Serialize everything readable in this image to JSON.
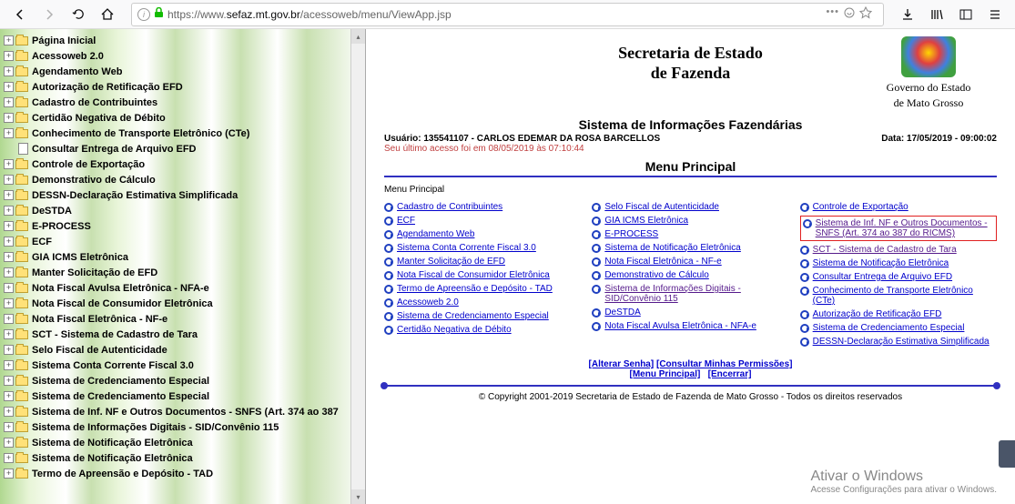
{
  "browser": {
    "url_prefix": "https://www.",
    "url_domain": "sefaz.mt.gov.br",
    "url_path": "/acessoweb/menu/ViewApp.jsp"
  },
  "tree": [
    {
      "label": "Página Inicial",
      "icon": "folder"
    },
    {
      "label": "Acessoweb 2.0",
      "icon": "folder"
    },
    {
      "label": "Agendamento Web",
      "icon": "folder"
    },
    {
      "label": "Autorização de Retificação EFD",
      "icon": "folder"
    },
    {
      "label": "Cadastro de Contribuintes",
      "icon": "folder"
    },
    {
      "label": "Certidão Negativa de Débito",
      "icon": "folder"
    },
    {
      "label": "Conhecimento de Transporte Eletrônico (CTe)",
      "icon": "folder"
    },
    {
      "label": "Consultar Entrega de Arquivo EFD",
      "icon": "doc",
      "child": true
    },
    {
      "label": "Controle de Exportação",
      "icon": "folder"
    },
    {
      "label": "Demonstrativo de Cálculo",
      "icon": "folder"
    },
    {
      "label": "DESSN-Declaração Estimativa Simplificada",
      "icon": "folder"
    },
    {
      "label": "DeSTDA",
      "icon": "folder"
    },
    {
      "label": "E-PROCESS",
      "icon": "folder"
    },
    {
      "label": "ECF",
      "icon": "folder"
    },
    {
      "label": "GIA ICMS Eletrônica",
      "icon": "folder"
    },
    {
      "label": "Manter Solicitação de EFD",
      "icon": "folder"
    },
    {
      "label": "Nota Fiscal Avulsa Eletrônica - NFA-e",
      "icon": "folder"
    },
    {
      "label": "Nota Fiscal de Consumidor Eletrônica",
      "icon": "folder"
    },
    {
      "label": "Nota Fiscal Eletrônica - NF-e",
      "icon": "folder"
    },
    {
      "label": "SCT - Sistema de Cadastro de Tara",
      "icon": "folder"
    },
    {
      "label": "Selo Fiscal de Autenticidade",
      "icon": "folder"
    },
    {
      "label": "Sistema Conta Corrente Fiscal 3.0",
      "icon": "folder"
    },
    {
      "label": "Sistema de Credenciamento Especial",
      "icon": "folder"
    },
    {
      "label": "Sistema de Credenciamento Especial",
      "icon": "folder"
    },
    {
      "label": "Sistema de Inf. NF e Outros Documentos - SNFS (Art. 374 ao 387",
      "icon": "folder"
    },
    {
      "label": "Sistema de Informações Digitais - SID/Convênio 115",
      "icon": "folder"
    },
    {
      "label": "Sistema de Notificação Eletrônica",
      "icon": "folder"
    },
    {
      "label": "Sistema de Notificação Eletrônica",
      "icon": "folder"
    },
    {
      "label": "Termo de Apreensão e Depósito - TAD",
      "icon": "folder"
    }
  ],
  "header": {
    "title_line1": "Secretaria de Estado",
    "title_line2": "de Fazenda",
    "gov_line1": "Governo do Estado",
    "gov_line2": "de Mato Grosso",
    "system_title": "Sistema de Informações Fazendárias",
    "user_label": "Usuário:",
    "user_value": "135541107 - CARLOS EDEMAR DA ROSA BARCELLOS",
    "date_label": "Data:",
    "date_value": "17/05/2019 - 09:00:02",
    "last_access": "Seu último acesso foi em 08/05/2019 às 07:10:44",
    "menu_title": "Menu Principal",
    "section": "Menu Principal"
  },
  "menu_columns": [
    [
      {
        "t": "Cadastro de Contribuintes"
      },
      {
        "t": "ECF"
      },
      {
        "t": "Agendamento Web"
      },
      {
        "t": "Sistema Conta Corrente Fiscal 3.0"
      },
      {
        "t": "Manter Solicitação de EFD"
      },
      {
        "t": "Nota Fiscal de Consumidor Eletrônica"
      },
      {
        "t": "Termo de Apreensão e Depósito - TAD"
      },
      {
        "t": "Acessoweb 2.0"
      },
      {
        "t": "Sistema de Credenciamento Especial"
      },
      {
        "t": "Certidão Negativa de Débito"
      }
    ],
    [
      {
        "t": "Selo Fiscal de Autenticidade"
      },
      {
        "t": "GIA ICMS Eletrônica"
      },
      {
        "t": "E-PROCESS"
      },
      {
        "t": "Sistema de Notificação Eletrônica"
      },
      {
        "t": "Nota Fiscal Eletrônica - NF-e"
      },
      {
        "t": "Demonstrativo de Cálculo"
      },
      {
        "t": "Sistema de Informações Digitais - SID/Convênio 115",
        "visited": true
      },
      {
        "t": "DeSTDA"
      },
      {
        "t": "Nota Fiscal Avulsa Eletrônica - NFA-e"
      }
    ],
    [
      {
        "t": "Controle de Exportação"
      },
      {
        "t": "Sistema de Inf. NF e Outros Documentos - SNFS (Art. 374 ao 387 do RICMS)",
        "visited": true,
        "highlight": true
      },
      {
        "t": "SCT - Sistema de Cadastro de Tara",
        "visited": true
      },
      {
        "t": "Sistema de Notificação Eletrônica"
      },
      {
        "t": "Consultar Entrega de Arquivo EFD"
      },
      {
        "t": "Conhecimento de Transporte Eletrônico (CTe)"
      },
      {
        "t": "Autorização de Retificação EFD"
      },
      {
        "t": "Sistema de Credenciamento Especial"
      },
      {
        "t": "DESSN-Declaração Estimativa Simplificada"
      }
    ]
  ],
  "footer": {
    "alterar": "[Alterar Senha]",
    "permissoes": "[Consultar Minhas Permissões]",
    "menu": "[Menu Principal]",
    "encerrar": "[Encerrar]",
    "copyright": "© Copyright 2001-2019 Secretaria de Estado de Fazenda de Mato Grosso - Todos os direitos reservados"
  },
  "watermark": {
    "line1": "Ativar o Windows",
    "line2": "Acesse Configurações para ativar o Windows."
  }
}
